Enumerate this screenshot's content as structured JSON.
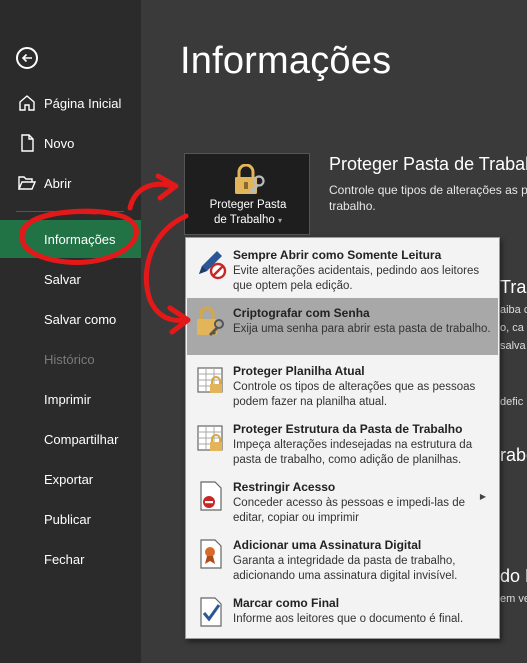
{
  "sidebar": {
    "items": [
      {
        "label": "Página Inicial",
        "icon": "home-icon"
      },
      {
        "label": "Novo",
        "icon": "new-document-icon"
      },
      {
        "label": "Abrir",
        "icon": "folder-open-icon"
      },
      {
        "label": "Informações"
      },
      {
        "label": "Salvar"
      },
      {
        "label": "Salvar como"
      },
      {
        "label": "Histórico"
      },
      {
        "label": "Imprimir"
      },
      {
        "label": "Compartilhar"
      },
      {
        "label": "Exportar"
      },
      {
        "label": "Publicar"
      },
      {
        "label": "Fechar"
      }
    ]
  },
  "main": {
    "title": "Informações",
    "protect_button": {
      "line1": "Proteger Pasta",
      "line2": "de Trabalho",
      "caret": "▾"
    },
    "protect_section": {
      "title": "Proteger Pasta de Trabal",
      "description": "Controle que tipos de alterações as pe trabalho."
    },
    "background_fragments": {
      "f1": "Tra",
      "f2": "aiba c",
      "f3": "o, ca",
      "f4": "salva",
      "f5": "defic",
      "f6": "rabe",
      "f7": "do N",
      "f8": "em ve"
    }
  },
  "menu": {
    "items": [
      {
        "title": "Sempre Abrir como Somente Leitura",
        "desc": "Evite alterações acidentais, pedindo aos leitores que optem pela edição.",
        "icon": "pen-no-edit-icon"
      },
      {
        "title": "Criptografar com Senha",
        "desc": "Exija uma senha para abrir esta pasta de trabalho.",
        "icon": "lock-key-icon"
      },
      {
        "title": "Proteger Planilha Atual",
        "desc": "Controle os tipos de alterações que as pessoas podem fazer na planilha atual.",
        "icon": "sheet-lock-icon"
      },
      {
        "title": "Proteger Estrutura da Pasta de Trabalho",
        "desc": "Impeça alterações indesejadas na estrutura da pasta de trabalho, como adição de planilhas.",
        "icon": "workbook-lock-icon"
      },
      {
        "title": "Restringir Acesso",
        "desc": "Conceder acesso às pessoas e impedi-las de editar, copiar ou imprimir",
        "icon": "restrict-access-icon",
        "arrow": "▶"
      },
      {
        "title": "Adicionar uma Assinatura Digital",
        "desc": "Garanta a integridade da pasta de trabalho, adicionando uma assinatura digital invisível.",
        "icon": "digital-signature-icon"
      },
      {
        "title": "Marcar como Final",
        "desc": "Informe aos leitores que o documento é final.",
        "icon": "mark-final-icon"
      }
    ]
  },
  "colors": {
    "accent": "#217346",
    "sidebar": "#2b2b2b",
    "background": "#3a3a3a",
    "annotation": "#e31919",
    "menu_highlight": "#a8a8a8"
  }
}
